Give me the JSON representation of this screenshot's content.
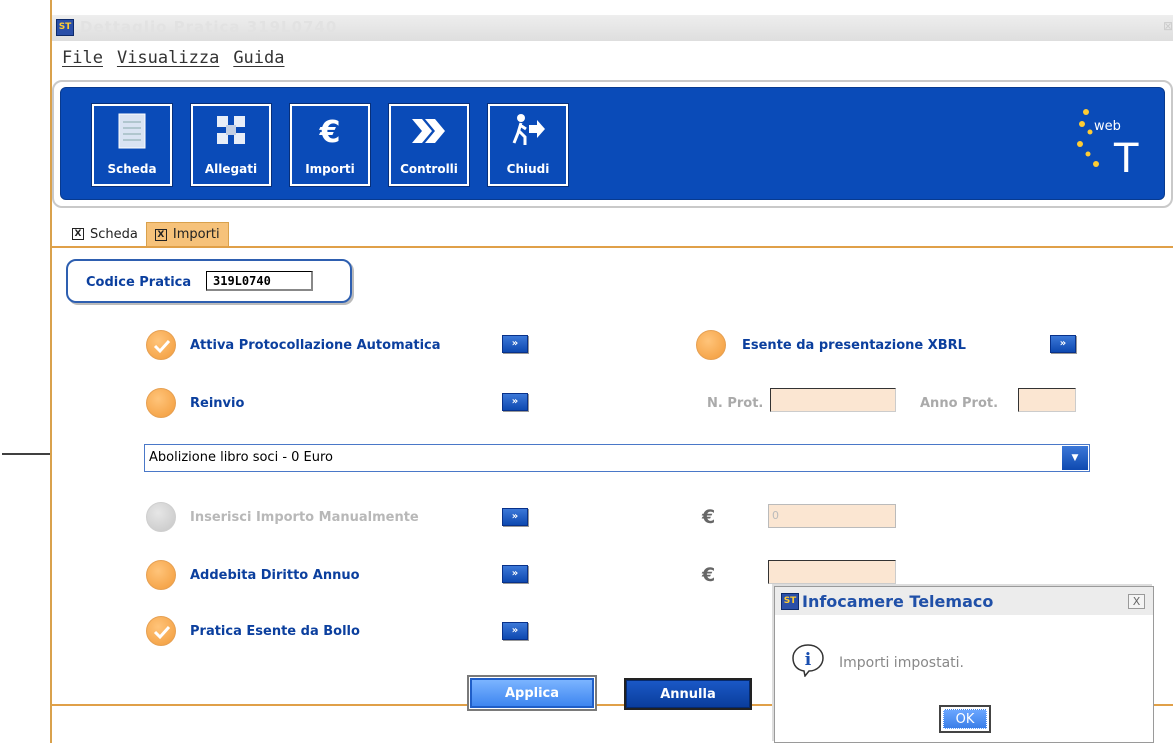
{
  "window": {
    "title": "Dettaglio Pratica 319L0740",
    "app_icon": "ST"
  },
  "menu": [
    "File",
    "Visualizza",
    "Guida"
  ],
  "toolbar": {
    "buttons": [
      {
        "label": "Scheda",
        "icon": "document-icon"
      },
      {
        "label": "Allegati",
        "icon": "attachments-icon"
      },
      {
        "label": "Importi",
        "icon": "euro-icon"
      },
      {
        "label": "Controlli",
        "icon": "double-chevron-icon"
      },
      {
        "label": "Chiudi",
        "icon": "exit-icon"
      }
    ],
    "logo_text": "web",
    "logo_letter": "T"
  },
  "tabs": [
    {
      "label": "Scheda",
      "close": "X",
      "active": false
    },
    {
      "label": "Importi",
      "close": "X",
      "active": true
    }
  ],
  "form": {
    "codice_label": "Codice Pratica",
    "codice_value": "319L0740",
    "options": {
      "protocollazione": {
        "label": "Attiva Protocollazione Automatica",
        "checked": true
      },
      "xbrl": {
        "label": "Esente da presentazione XBRL",
        "checked": false
      },
      "reinvio": {
        "label": "Reinvio",
        "checked": false
      },
      "importo_manuale": {
        "label": "Inserisci Importo Manualmente",
        "enabled": false
      },
      "diritto_annuo": {
        "label": "Addebita Diritto Annuo",
        "checked": false
      },
      "esente_bollo": {
        "label": "Pratica Esente da Bollo",
        "checked": true
      }
    },
    "n_prot_label": "N. Prot.",
    "anno_prot_label": "Anno Prot.",
    "select_value": "Abolizione libro soci - 0 Euro",
    "euro_symbol": "€",
    "importo_manuale_value": "0",
    "arrow_glyph": "»",
    "applica_label": "Applica",
    "annulla_label": "Annulla"
  },
  "dialog": {
    "title": "Infocamere Telemaco",
    "message": "Importi impostati.",
    "ok_label": "OK",
    "close": "X"
  },
  "colors": {
    "accent": "#0a4bb8",
    "orange": "#f29b3a",
    "label_blue": "#0b3f9e"
  }
}
